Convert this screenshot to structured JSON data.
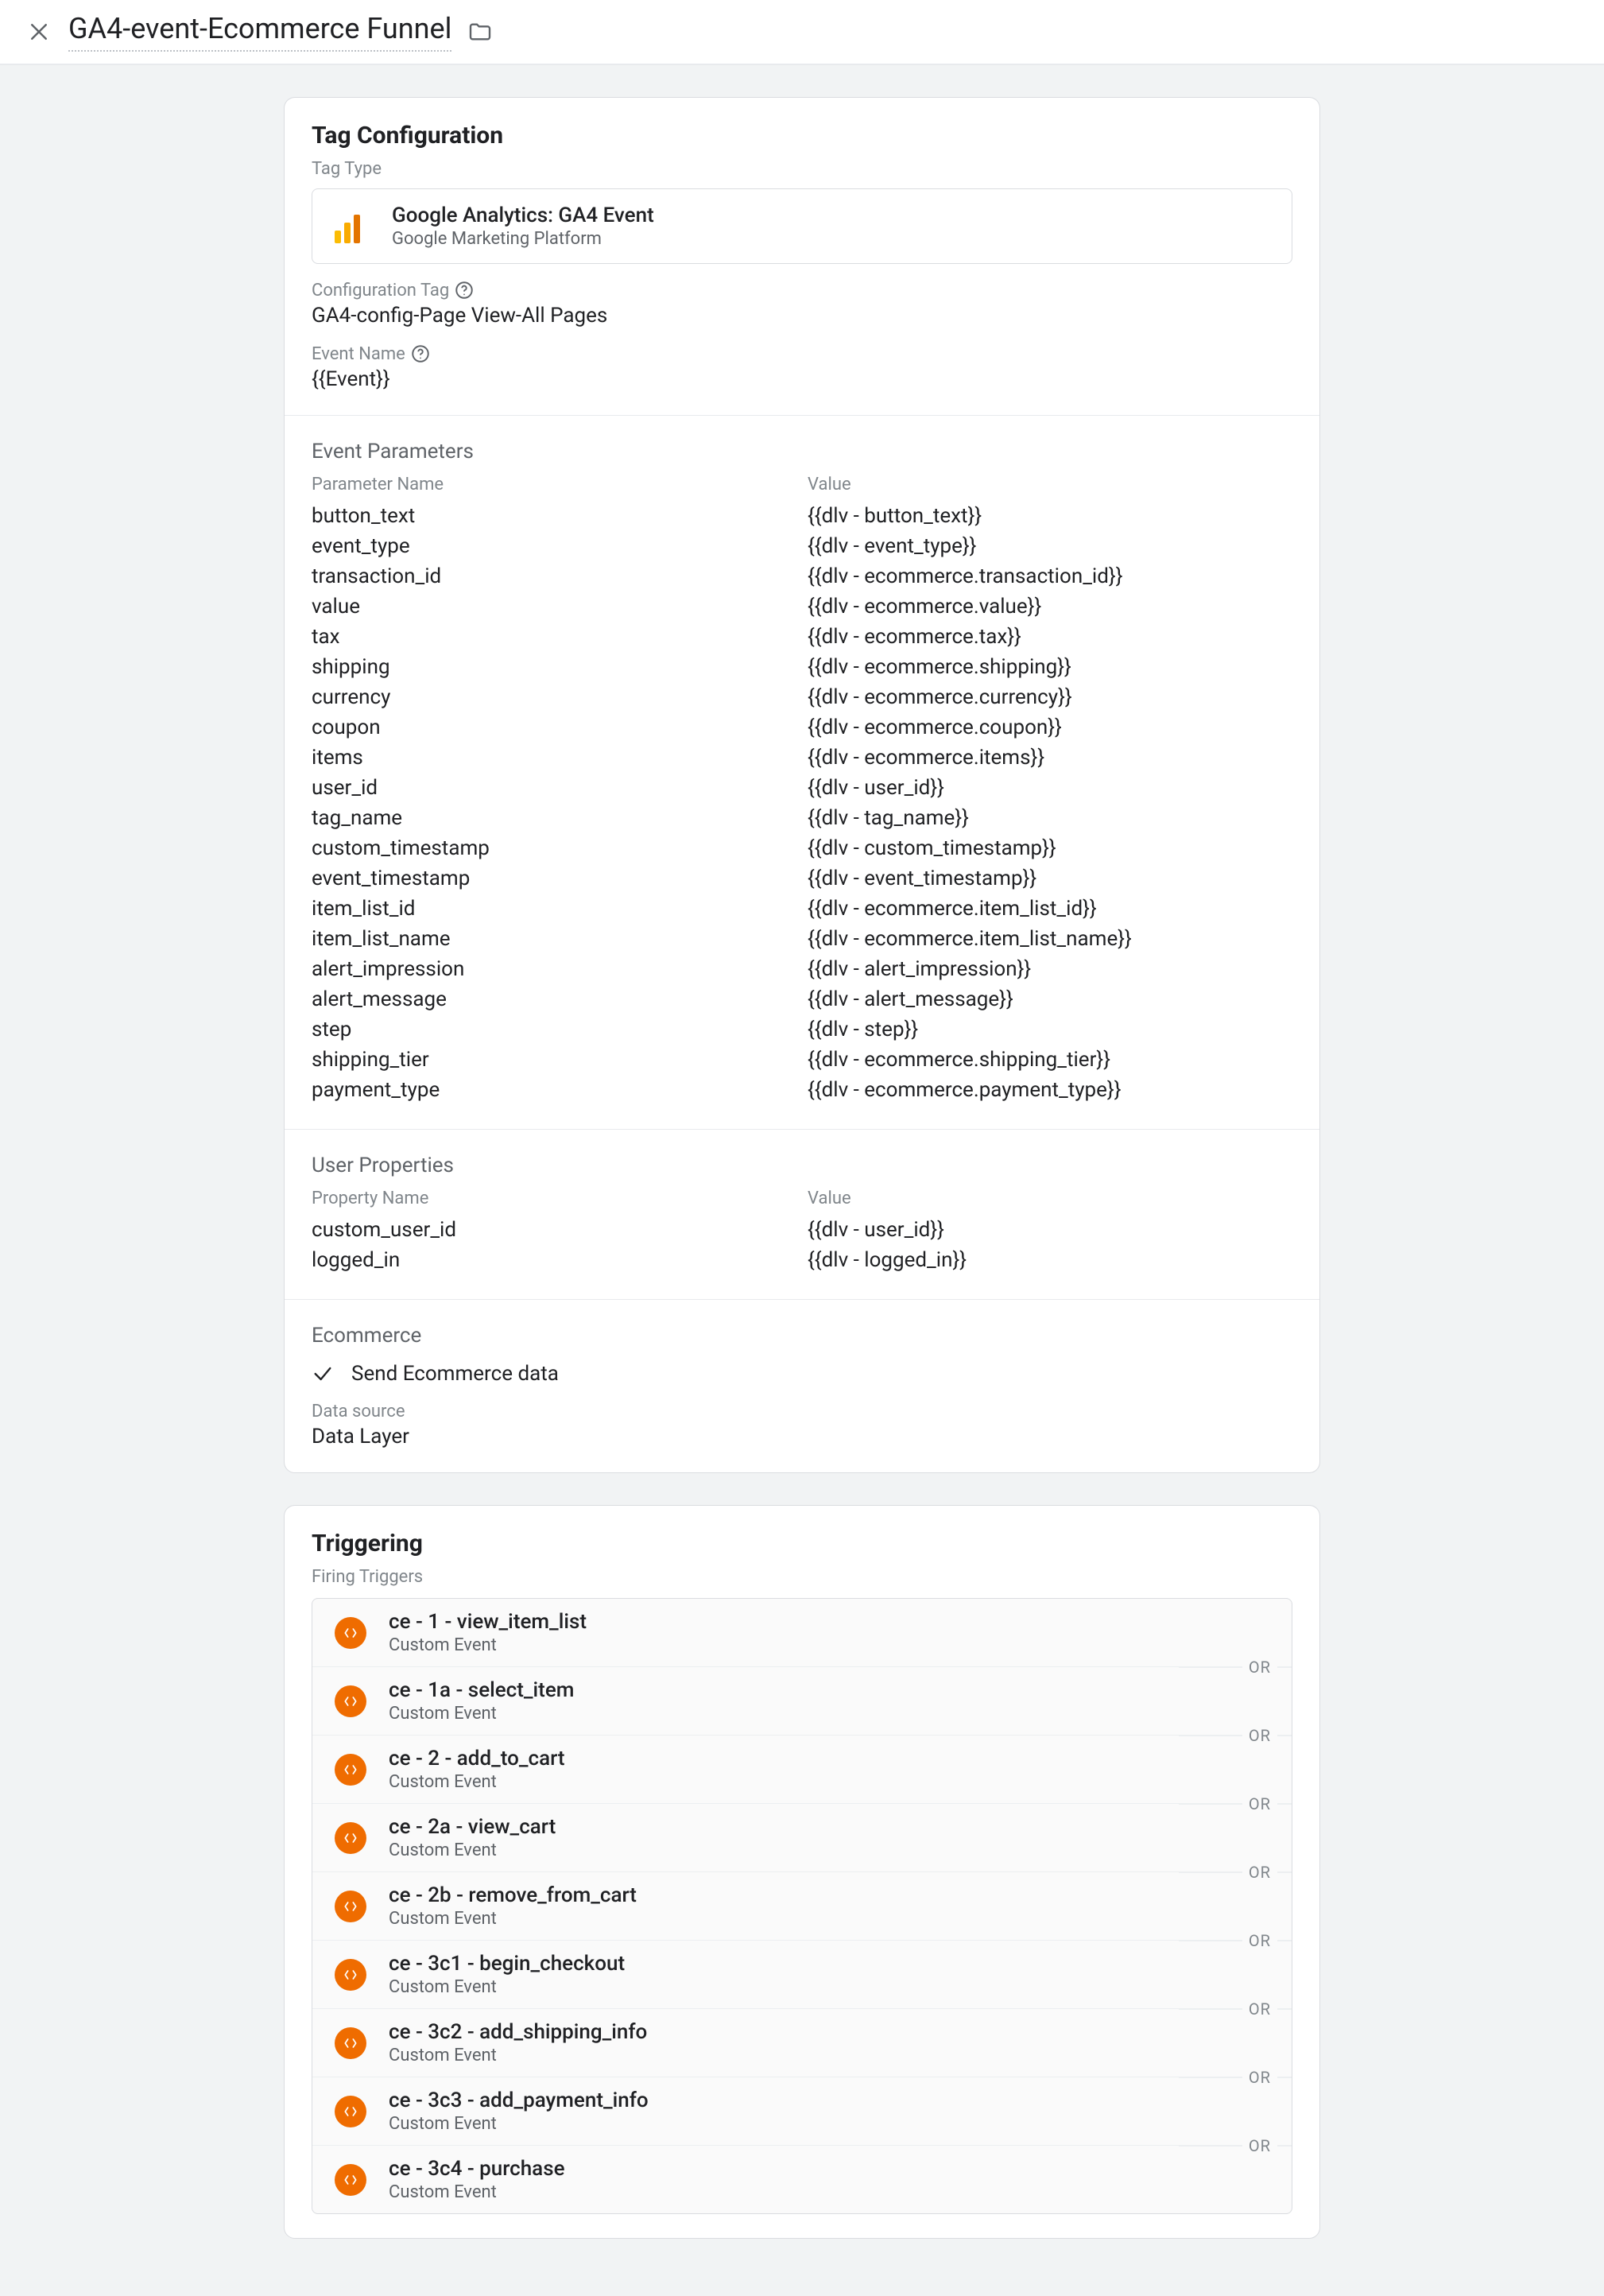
{
  "topbar": {
    "title": "GA4-event-Ecommerce Funnel"
  },
  "tagConfig": {
    "heading": "Tag Configuration",
    "tagTypeLabel": "Tag Type",
    "tagTypeTitle": "Google Analytics: GA4 Event",
    "tagTypeSubtitle": "Google Marketing Platform",
    "configTagLabel": "Configuration Tag",
    "configTagValue": "GA4-config-Page View-All Pages",
    "eventNameLabel": "Event Name",
    "eventNameValue": "{{Event}}",
    "eventParamsHeading": "Event Parameters",
    "paramNameHeader": "Parameter Name",
    "paramValueHeader": "Value",
    "eventParams": [
      {
        "name": "button_text",
        "value": "{{dlv - button_text}}"
      },
      {
        "name": "event_type",
        "value": "{{dlv - event_type}}"
      },
      {
        "name": "transaction_id",
        "value": "{{dlv - ecommerce.transaction_id}}"
      },
      {
        "name": "value",
        "value": "{{dlv - ecommerce.value}}"
      },
      {
        "name": "tax",
        "value": "{{dlv - ecommerce.tax}}"
      },
      {
        "name": "shipping",
        "value": "{{dlv - ecommerce.shipping}}"
      },
      {
        "name": "currency",
        "value": "{{dlv - ecommerce.currency}}"
      },
      {
        "name": "coupon",
        "value": "{{dlv - ecommerce.coupon}}"
      },
      {
        "name": "items",
        "value": "{{dlv - ecommerce.items}}"
      },
      {
        "name": "user_id",
        "value": "{{dlv - user_id}}"
      },
      {
        "name": "tag_name",
        "value": "{{dlv - tag_name}}"
      },
      {
        "name": "custom_timestamp",
        "value": "{{dlv - custom_timestamp}}"
      },
      {
        "name": "event_timestamp",
        "value": "{{dlv - event_timestamp}}"
      },
      {
        "name": "item_list_id",
        "value": "{{dlv - ecommerce.item_list_id}}"
      },
      {
        "name": "item_list_name",
        "value": "{{dlv - ecommerce.item_list_name}}"
      },
      {
        "name": "alert_impression",
        "value": "{{dlv - alert_impression}}"
      },
      {
        "name": "alert_message",
        "value": "{{dlv - alert_message}}"
      },
      {
        "name": "step",
        "value": "{{dlv - step}}"
      },
      {
        "name": "shipping_tier",
        "value": "{{dlv - ecommerce.shipping_tier}}"
      },
      {
        "name": "payment_type",
        "value": "{{dlv - ecommerce.payment_type}}"
      }
    ],
    "userPropsHeading": "User Properties",
    "userPropsNameHeader": "Property Name",
    "userPropsValueHeader": "Value",
    "userProps": [
      {
        "name": "custom_user_id",
        "value": "{{dlv - user_id}}"
      },
      {
        "name": "logged_in",
        "value": "{{dlv - logged_in}}"
      }
    ],
    "ecommerceHeading": "Ecommerce",
    "ecommerceLabel": "Send Ecommerce data",
    "dataSourceLabel": "Data source",
    "dataSourceValue": "Data Layer"
  },
  "triggering": {
    "heading": "Triggering",
    "firingLabel": "Firing Triggers",
    "orLabel": "OR",
    "items": [
      {
        "title": "ce - 1 - view_item_list",
        "subtitle": "Custom Event"
      },
      {
        "title": "ce - 1a - select_item",
        "subtitle": "Custom Event"
      },
      {
        "title": "ce - 2 - add_to_cart",
        "subtitle": "Custom Event"
      },
      {
        "title": "ce - 2a - view_cart",
        "subtitle": "Custom Event"
      },
      {
        "title": "ce - 2b - remove_from_cart",
        "subtitle": "Custom Event"
      },
      {
        "title": "ce - 3c1 - begin_checkout",
        "subtitle": "Custom Event"
      },
      {
        "title": "ce - 3c2 - add_shipping_info",
        "subtitle": "Custom Event"
      },
      {
        "title": "ce - 3c3 - add_payment_info",
        "subtitle": "Custom Event"
      },
      {
        "title": "ce - 3c4 - purchase",
        "subtitle": "Custom Event"
      }
    ]
  }
}
